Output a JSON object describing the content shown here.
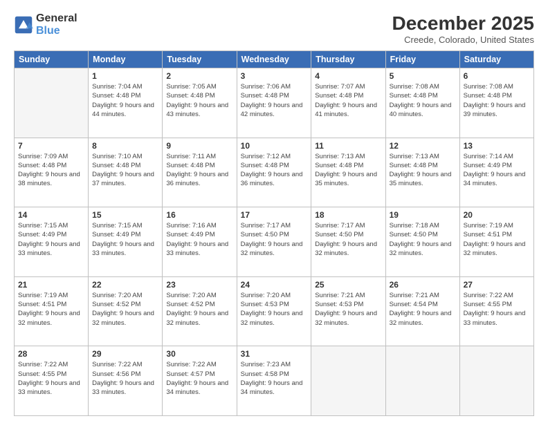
{
  "logo": {
    "general": "General",
    "blue": "Blue"
  },
  "title": "December 2025",
  "location": "Creede, Colorado, United States",
  "days_of_week": [
    "Sunday",
    "Monday",
    "Tuesday",
    "Wednesday",
    "Thursday",
    "Friday",
    "Saturday"
  ],
  "weeks": [
    [
      {
        "day": "",
        "sunrise": "",
        "sunset": "",
        "daylight": "",
        "empty": true
      },
      {
        "day": "1",
        "sunrise": "Sunrise: 7:04 AM",
        "sunset": "Sunset: 4:48 PM",
        "daylight": "Daylight: 9 hours and 44 minutes."
      },
      {
        "day": "2",
        "sunrise": "Sunrise: 7:05 AM",
        "sunset": "Sunset: 4:48 PM",
        "daylight": "Daylight: 9 hours and 43 minutes."
      },
      {
        "day": "3",
        "sunrise": "Sunrise: 7:06 AM",
        "sunset": "Sunset: 4:48 PM",
        "daylight": "Daylight: 9 hours and 42 minutes."
      },
      {
        "day": "4",
        "sunrise": "Sunrise: 7:07 AM",
        "sunset": "Sunset: 4:48 PM",
        "daylight": "Daylight: 9 hours and 41 minutes."
      },
      {
        "day": "5",
        "sunrise": "Sunrise: 7:08 AM",
        "sunset": "Sunset: 4:48 PM",
        "daylight": "Daylight: 9 hours and 40 minutes."
      },
      {
        "day": "6",
        "sunrise": "Sunrise: 7:08 AM",
        "sunset": "Sunset: 4:48 PM",
        "daylight": "Daylight: 9 hours and 39 minutes."
      }
    ],
    [
      {
        "day": "7",
        "sunrise": "Sunrise: 7:09 AM",
        "sunset": "Sunset: 4:48 PM",
        "daylight": "Daylight: 9 hours and 38 minutes."
      },
      {
        "day": "8",
        "sunrise": "Sunrise: 7:10 AM",
        "sunset": "Sunset: 4:48 PM",
        "daylight": "Daylight: 9 hours and 37 minutes."
      },
      {
        "day": "9",
        "sunrise": "Sunrise: 7:11 AM",
        "sunset": "Sunset: 4:48 PM",
        "daylight": "Daylight: 9 hours and 36 minutes."
      },
      {
        "day": "10",
        "sunrise": "Sunrise: 7:12 AM",
        "sunset": "Sunset: 4:48 PM",
        "daylight": "Daylight: 9 hours and 36 minutes."
      },
      {
        "day": "11",
        "sunrise": "Sunrise: 7:13 AM",
        "sunset": "Sunset: 4:48 PM",
        "daylight": "Daylight: 9 hours and 35 minutes."
      },
      {
        "day": "12",
        "sunrise": "Sunrise: 7:13 AM",
        "sunset": "Sunset: 4:48 PM",
        "daylight": "Daylight: 9 hours and 35 minutes."
      },
      {
        "day": "13",
        "sunrise": "Sunrise: 7:14 AM",
        "sunset": "Sunset: 4:49 PM",
        "daylight": "Daylight: 9 hours and 34 minutes."
      }
    ],
    [
      {
        "day": "14",
        "sunrise": "Sunrise: 7:15 AM",
        "sunset": "Sunset: 4:49 PM",
        "daylight": "Daylight: 9 hours and 33 minutes."
      },
      {
        "day": "15",
        "sunrise": "Sunrise: 7:15 AM",
        "sunset": "Sunset: 4:49 PM",
        "daylight": "Daylight: 9 hours and 33 minutes."
      },
      {
        "day": "16",
        "sunrise": "Sunrise: 7:16 AM",
        "sunset": "Sunset: 4:49 PM",
        "daylight": "Daylight: 9 hours and 33 minutes."
      },
      {
        "day": "17",
        "sunrise": "Sunrise: 7:17 AM",
        "sunset": "Sunset: 4:50 PM",
        "daylight": "Daylight: 9 hours and 32 minutes."
      },
      {
        "day": "18",
        "sunrise": "Sunrise: 7:17 AM",
        "sunset": "Sunset: 4:50 PM",
        "daylight": "Daylight: 9 hours and 32 minutes."
      },
      {
        "day": "19",
        "sunrise": "Sunrise: 7:18 AM",
        "sunset": "Sunset: 4:50 PM",
        "daylight": "Daylight: 9 hours and 32 minutes."
      },
      {
        "day": "20",
        "sunrise": "Sunrise: 7:19 AM",
        "sunset": "Sunset: 4:51 PM",
        "daylight": "Daylight: 9 hours and 32 minutes."
      }
    ],
    [
      {
        "day": "21",
        "sunrise": "Sunrise: 7:19 AM",
        "sunset": "Sunset: 4:51 PM",
        "daylight": "Daylight: 9 hours and 32 minutes."
      },
      {
        "day": "22",
        "sunrise": "Sunrise: 7:20 AM",
        "sunset": "Sunset: 4:52 PM",
        "daylight": "Daylight: 9 hours and 32 minutes."
      },
      {
        "day": "23",
        "sunrise": "Sunrise: 7:20 AM",
        "sunset": "Sunset: 4:52 PM",
        "daylight": "Daylight: 9 hours and 32 minutes."
      },
      {
        "day": "24",
        "sunrise": "Sunrise: 7:20 AM",
        "sunset": "Sunset: 4:53 PM",
        "daylight": "Daylight: 9 hours and 32 minutes."
      },
      {
        "day": "25",
        "sunrise": "Sunrise: 7:21 AM",
        "sunset": "Sunset: 4:53 PM",
        "daylight": "Daylight: 9 hours and 32 minutes."
      },
      {
        "day": "26",
        "sunrise": "Sunrise: 7:21 AM",
        "sunset": "Sunset: 4:54 PM",
        "daylight": "Daylight: 9 hours and 32 minutes."
      },
      {
        "day": "27",
        "sunrise": "Sunrise: 7:22 AM",
        "sunset": "Sunset: 4:55 PM",
        "daylight": "Daylight: 9 hours and 33 minutes."
      }
    ],
    [
      {
        "day": "28",
        "sunrise": "Sunrise: 7:22 AM",
        "sunset": "Sunset: 4:55 PM",
        "daylight": "Daylight: 9 hours and 33 minutes."
      },
      {
        "day": "29",
        "sunrise": "Sunrise: 7:22 AM",
        "sunset": "Sunset: 4:56 PM",
        "daylight": "Daylight: 9 hours and 33 minutes."
      },
      {
        "day": "30",
        "sunrise": "Sunrise: 7:22 AM",
        "sunset": "Sunset: 4:57 PM",
        "daylight": "Daylight: 9 hours and 34 minutes."
      },
      {
        "day": "31",
        "sunrise": "Sunrise: 7:23 AM",
        "sunset": "Sunset: 4:58 PM",
        "daylight": "Daylight: 9 hours and 34 minutes."
      },
      {
        "day": "",
        "sunrise": "",
        "sunset": "",
        "daylight": "",
        "empty": true
      },
      {
        "day": "",
        "sunrise": "",
        "sunset": "",
        "daylight": "",
        "empty": true
      },
      {
        "day": "",
        "sunrise": "",
        "sunset": "",
        "daylight": "",
        "empty": true
      }
    ]
  ]
}
